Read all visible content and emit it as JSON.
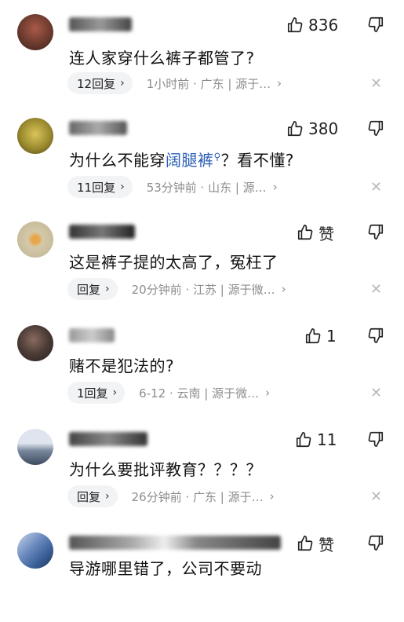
{
  "comments": [
    {
      "likes": "836",
      "text_before": "连人家穿什么裤子都管了?",
      "highlight": "",
      "text_after": "",
      "replies": "12回复",
      "meta": "1小时前 · 广东 | 源于…",
      "meta_chev": "›",
      "avatar_color": "#6b3a2e",
      "name_width": 80
    },
    {
      "likes": "380",
      "text_before": "为什么不能穿",
      "highlight": "阔腿裤",
      "text_after": "？看不懂?",
      "replies": "11回复",
      "meta": "53分钟前 · 山东 | 源…",
      "meta_chev": "›",
      "avatar_color": "#9a8a2e",
      "name_width": 74
    },
    {
      "likes": "赞",
      "text_before": "这是裤子提的太高了，冤枉了",
      "highlight": "",
      "text_after": "",
      "replies": "回复",
      "meta": "20分钟前 · 江苏 | 源于微…",
      "meta_chev": "›",
      "avatar_color": "#d4c9a8",
      "name_width": 84
    },
    {
      "likes": "1",
      "text_before": "赌不是犯法的?",
      "highlight": "",
      "text_after": "",
      "replies": "1回复",
      "meta": "6-12 · 云南 | 源于微…",
      "meta_chev": "›",
      "avatar_color": "#4a3b36",
      "name_width": 58
    },
    {
      "likes": "11",
      "text_before": "为什么要批评教育？？？？",
      "highlight": "",
      "text_after": "",
      "replies": "回复",
      "meta": "26分钟前 · 广东 | 源于…",
      "meta_chev": "›",
      "avatar_color": "#7b8aa0",
      "name_width": 100
    },
    {
      "likes": "赞",
      "text_before": "导游哪里错了，公司不要动",
      "highlight": "",
      "text_after": "",
      "replies": "",
      "meta": "",
      "meta_chev": "",
      "avatar_color": "#3a5f98",
      "name_width": 270
    }
  ],
  "icons": {
    "like": "thumbs-up-icon",
    "dislike": "thumbs-down-icon",
    "close": "close-icon",
    "chevron": "chevron-right-icon"
  }
}
